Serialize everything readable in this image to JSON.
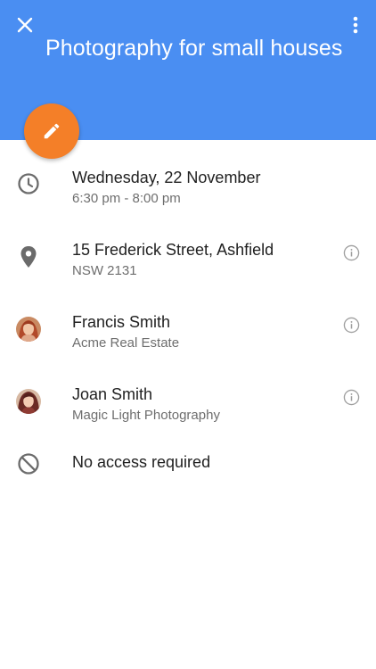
{
  "header": {
    "title": "Photography for small houses",
    "close_icon": "close-icon",
    "more_icon": "more-vertical-icon",
    "background": "#4a8ef2"
  },
  "fab": {
    "icon": "pencil-icon",
    "color": "#f47f28"
  },
  "details": {
    "datetime": {
      "icon": "clock-icon",
      "primary": "Wednesday, 22 November",
      "secondary": "6:30 pm - 8:00 pm"
    },
    "location": {
      "icon": "location-pin-icon",
      "primary": "15 Frederick Street, Ashfield",
      "secondary": "NSW 2131",
      "info_icon": "info-icon"
    },
    "contacts": [
      {
        "name": "Francis Smith",
        "company": "Acme Real Estate",
        "info_icon": "info-icon"
      },
      {
        "name": "Joan Smith",
        "company": "Magic Light Photography",
        "info_icon": "info-icon"
      }
    ],
    "access": {
      "icon": "block-icon",
      "primary": "No access required"
    }
  }
}
